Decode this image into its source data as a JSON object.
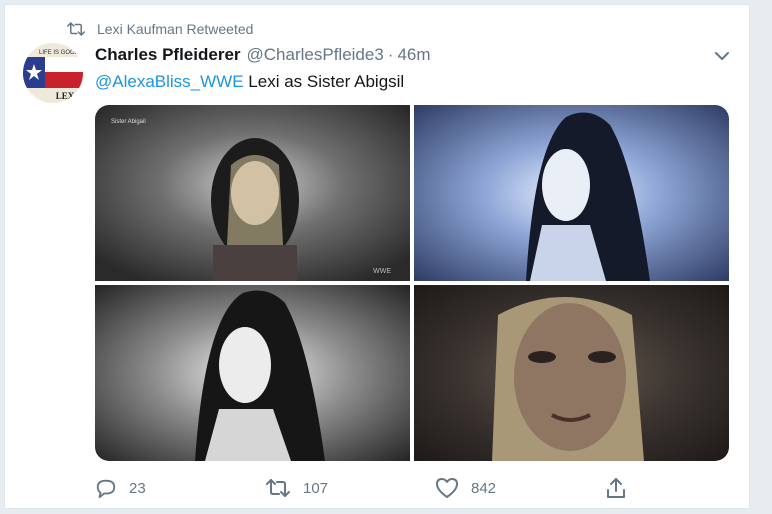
{
  "retweet_banner": {
    "text": "Lexi Kaufman Retweeted"
  },
  "tweet": {
    "author_name": "Charles Pfleiderer",
    "handle": "@CharlesPfleide3",
    "separator": "·",
    "time": "46m",
    "mention": "@AlexaBliss_WWE",
    "body": "Lexi as Sister Abigsil"
  },
  "avatar": {
    "top_text": "LIFE IS GOOD",
    "bottom_text": "LEX"
  },
  "media": {
    "image1_watermark": "Sister Abigail",
    "image1_corner_mark": "WWE"
  },
  "actions": {
    "reply_count": "23",
    "retweet_count": "107",
    "like_count": "842"
  },
  "colors": {
    "accent": "#1b95e0",
    "muted": "#657786"
  }
}
